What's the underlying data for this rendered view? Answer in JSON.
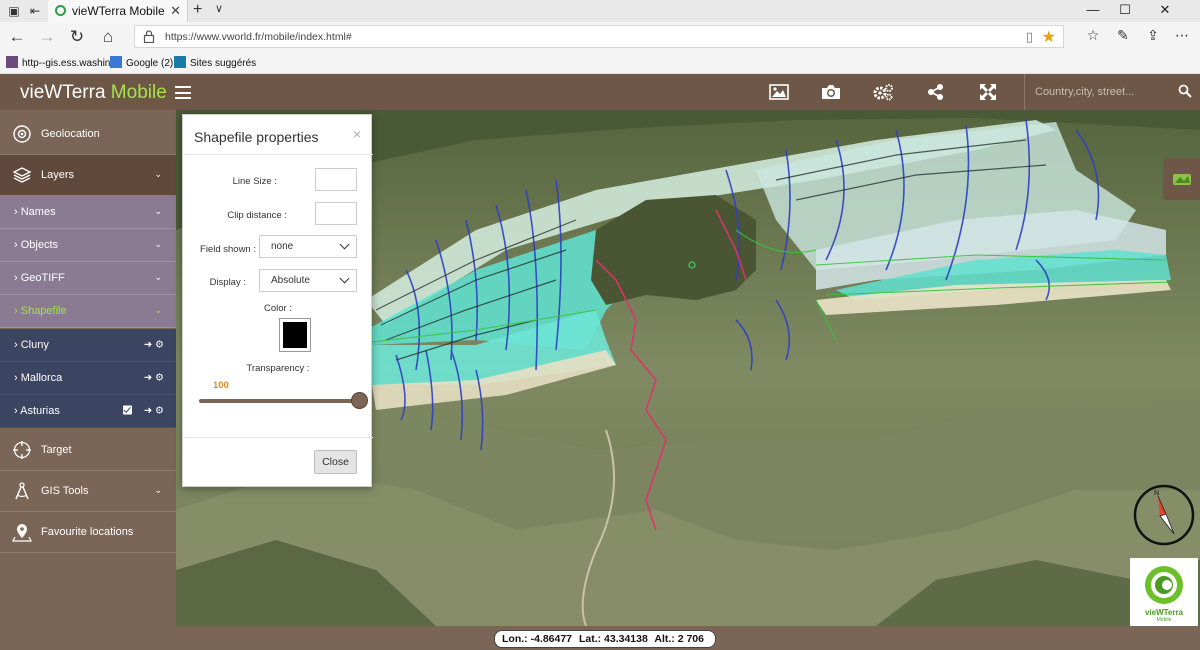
{
  "browser": {
    "tab_title": "vieWTerra Mobile",
    "url": "https://www.vworld.fr/mobile/index.html#",
    "favorites": [
      {
        "label": "http--gis.ess.washing"
      },
      {
        "label": "Google (2)"
      },
      {
        "label": "Sites suggérés"
      }
    ]
  },
  "header": {
    "brand_main": "vieWTerra",
    "brand_accent": "Mobile",
    "search_placeholder": "Country,city, street..."
  },
  "sidebar": {
    "geolocation": "Geolocation",
    "layers": "Layers",
    "names": "Names",
    "objects": "Objects",
    "geotiff": "GeoTIFF",
    "shapefile": "Shapefile",
    "layers_list": [
      {
        "label": "Cluny",
        "checked": false
      },
      {
        "label": "Mallorca",
        "checked": false
      },
      {
        "label": "Asturias",
        "checked": true
      }
    ],
    "target": "Target",
    "gis_tools": "GIS Tools",
    "favourite_locations": "Favourite locations"
  },
  "dialog": {
    "title": "Shapefile properties",
    "line_size_label": "Line Size :",
    "line_size_value": "",
    "clip_distance_label": "Clip distance :",
    "clip_distance_value": "",
    "field_shown_label": "Field shown :",
    "field_shown_value": "none",
    "display_label": "Display :",
    "display_value": "Absolute",
    "color_label": "Color :",
    "color_value": "#000000",
    "transparency_label": "Transparency :",
    "transparency_value": "100",
    "close_label": "Close"
  },
  "status": {
    "lon": "Lon.: -4.86477",
    "lat": "Lat.: 43.34138",
    "alt": "Alt.: 2 706"
  },
  "logo": {
    "text": "vieWTerra",
    "sub": "Mobile"
  },
  "colors": {
    "header": "#6e5747",
    "sidebar": "#7a6556",
    "accent_green": "#a6e24a",
    "sub_menu": "#8a7a92",
    "layer_row": "#3b4460"
  }
}
